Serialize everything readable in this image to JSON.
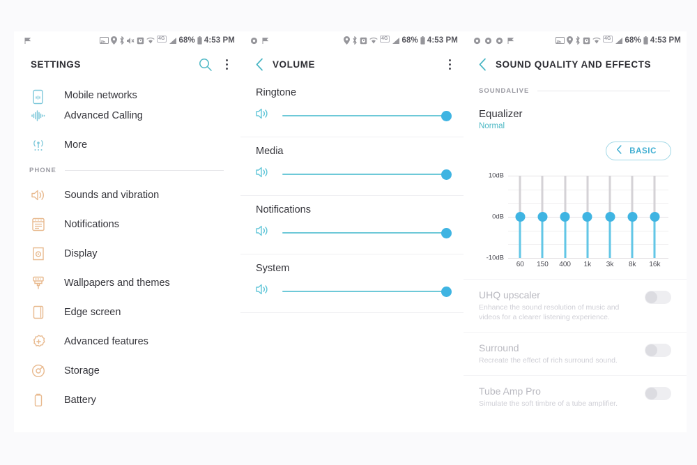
{
  "statusbars": {
    "settings": {
      "left_icons": [
        "flag-icon"
      ],
      "right_icons": [
        "screen-cast-icon",
        "location-icon",
        "bluetooth-icon",
        "mute-icon",
        "alarm-icon",
        "wifi-icon",
        "4g-icon",
        "signal-icon"
      ],
      "network_badge": "4G",
      "battery": "68%",
      "time": "4:53 PM"
    },
    "volume": {
      "left_icons": [
        "gear-icon",
        "flag-icon"
      ],
      "right_icons": [
        "location-icon",
        "bluetooth-icon",
        "alarm-icon",
        "wifi-icon",
        "4g-icon",
        "signal-icon"
      ],
      "network_badge": "4G",
      "battery": "68%",
      "time": "4:53 PM"
    },
    "sound": {
      "left_icons": [
        "gear-icon",
        "gear-icon",
        "gear-icon",
        "flag-icon"
      ],
      "right_icons": [
        "screen-cast-icon",
        "location-icon",
        "bluetooth-icon",
        "alarm-icon",
        "wifi-icon",
        "4g-icon",
        "signal-icon"
      ],
      "network_badge": "4G",
      "battery": "68%",
      "time": "4:53 PM"
    }
  },
  "settings_panel": {
    "title": "SETTINGS",
    "search_icon": "search-icon",
    "overflow_icon": "overflow-menu-icon",
    "items": [
      {
        "label": "Mobile networks",
        "icon": "mobile-networks-icon",
        "color": "#7ec8da",
        "clipped": true
      },
      {
        "label": "Advanced Calling",
        "icon": "advanced-calling-icon",
        "color": "#7ec8da",
        "clipped": false
      },
      {
        "label": "More",
        "icon": "more-connections-icon",
        "color": "#7ec8da",
        "clipped": false
      }
    ],
    "section_label": "PHONE",
    "phone_items": [
      {
        "label": "Sounds and vibration",
        "icon": "speaker-icon",
        "color": "#e8b98e"
      },
      {
        "label": "Notifications",
        "icon": "notifications-icon",
        "color": "#e8b98e"
      },
      {
        "label": "Display",
        "icon": "display-icon",
        "color": "#e8b98e"
      },
      {
        "label": "Wallpapers and themes",
        "icon": "paintbrush-icon",
        "color": "#e8b98e"
      },
      {
        "label": "Edge screen",
        "icon": "edge-screen-icon",
        "color": "#e8b98e"
      },
      {
        "label": "Advanced features",
        "icon": "gear-plus-icon",
        "color": "#e8b98e"
      },
      {
        "label": "Storage",
        "icon": "storage-icon",
        "color": "#e8b98e"
      },
      {
        "label": "Battery",
        "icon": "battery-icon",
        "color": "#e8b98e"
      }
    ]
  },
  "volume_panel": {
    "title": "VOLUME",
    "back_icon": "back-chevron-icon",
    "overflow_icon": "overflow-menu-icon",
    "sliders": [
      {
        "label": "Ringtone",
        "icon": "volume-icon",
        "value_pct": 96
      },
      {
        "label": "Media",
        "icon": "volume-icon",
        "value_pct": 96
      },
      {
        "label": "Notifications",
        "icon": "volume-icon",
        "value_pct": 96
      },
      {
        "label": "System",
        "icon": "volume-icon",
        "value_pct": 96
      }
    ]
  },
  "sound_panel": {
    "title": "SOUND QUALITY AND EFFECTS",
    "back_icon": "back-chevron-icon",
    "section_label": "SOUNDALIVE",
    "equalizer_title": "Equalizer",
    "equalizer_value": "Normal",
    "preset_button": {
      "label": "BASIC",
      "icon": "back-chevron-icon"
    },
    "toggles": [
      {
        "title": "UHQ upscaler",
        "desc": "Enhance the sound resolution of music and videos for a clearer listening experience.",
        "state": "off",
        "disabled": true
      },
      {
        "title": "Surround",
        "desc": "Recreate the effect of rich surround sound.",
        "state": "off",
        "disabled": true
      },
      {
        "title": "Tube Amp Pro",
        "desc": "Simulate the soft timbre of a tube amplifier.",
        "state": "off",
        "disabled": true
      }
    ]
  },
  "chart_data": {
    "type": "bar",
    "title": "Equalizer",
    "categories": [
      "60",
      "150",
      "400",
      "1k",
      "3k",
      "8k",
      "16k"
    ],
    "values": [
      0,
      0,
      0,
      0,
      0,
      0,
      0
    ],
    "xlabel": "",
    "ylabel": "dB",
    "ylim": [
      -10,
      10
    ],
    "ytick_labels": [
      "10dB",
      "0dB",
      "-10dB"
    ],
    "ytick_values": [
      10,
      0,
      -10
    ],
    "gridlines": true,
    "legend": "none",
    "accent_color": "#3fb4e2"
  }
}
